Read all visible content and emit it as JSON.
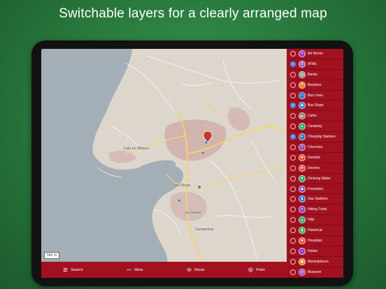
{
  "headline": "Switchable layers for a clearly arranged map",
  "map": {
    "scale_label": "500 m",
    "place_labels": [
      "Cala en Blanes",
      "San Diego",
      "sa Caleta",
      "Santandria"
    ]
  },
  "bottom_bar": {
    "search": "Search",
    "more": "More",
    "route": "Route",
    "point": "Point"
  },
  "layers": [
    {
      "label": "Art Works",
      "checked": false,
      "color": "#8e3cc4",
      "icon": "palette-icon",
      "glyph": "✎"
    },
    {
      "label": "ATMs",
      "checked": true,
      "color": "#9b59b6",
      "icon": "atm-icon",
      "glyph": "$"
    },
    {
      "label": "Banks",
      "checked": false,
      "color": "#7f8c8d",
      "icon": "bank-icon",
      "glyph": "▥"
    },
    {
      "label": "Beaches",
      "checked": false,
      "color": "#e67e22",
      "icon": "beach-icon",
      "glyph": "☂"
    },
    {
      "label": "Bus Lines",
      "checked": false,
      "color": "#2e6fd8",
      "icon": "bus-line-icon",
      "glyph": "▭"
    },
    {
      "label": "Bus Stops",
      "checked": true,
      "color": "#2e6fd8",
      "icon": "bus-stop-icon",
      "glyph": "▣"
    },
    {
      "label": "Cafes",
      "checked": false,
      "color": "#8d6e63",
      "icon": "cafe-icon",
      "glyph": "☕"
    },
    {
      "label": "Camping",
      "checked": false,
      "color": "#27ae60",
      "icon": "tent-icon",
      "glyph": "▲"
    },
    {
      "label": "Charging Stations",
      "checked": true,
      "color": "#2e6fd8",
      "icon": "charging-icon",
      "glyph": "⚡"
    },
    {
      "label": "Churches",
      "checked": false,
      "color": "#8e44ad",
      "icon": "church-icon",
      "glyph": "✝"
    },
    {
      "label": "Dentists",
      "checked": false,
      "color": "#e74c3c",
      "icon": "tooth-icon",
      "glyph": "✚"
    },
    {
      "label": "Doctors",
      "checked": false,
      "color": "#e74c3c",
      "icon": "doctor-icon",
      "glyph": "✚"
    },
    {
      "label": "Drinking Water",
      "checked": false,
      "color": "#27ae60",
      "icon": "water-icon",
      "glyph": "▼"
    },
    {
      "label": "Fountains",
      "checked": false,
      "color": "#8e44ad",
      "icon": "fountain-icon",
      "glyph": "◆"
    },
    {
      "label": "Gas Stations",
      "checked": false,
      "color": "#2e6fd8",
      "icon": "fuel-icon",
      "glyph": "▮"
    },
    {
      "label": "Hiking Trails",
      "checked": false,
      "color": "#8e3cc4",
      "icon": "hiking-icon",
      "glyph": "✈"
    },
    {
      "label": "Hills",
      "checked": false,
      "color": "#27ae60",
      "icon": "mountain-icon",
      "glyph": "▲"
    },
    {
      "label": "Historical",
      "checked": false,
      "color": "#27ae60",
      "icon": "monument-icon",
      "glyph": "▮"
    },
    {
      "label": "Hospitals",
      "checked": false,
      "color": "#e74c3c",
      "icon": "hospital-icon",
      "glyph": "✚"
    },
    {
      "label": "Hotels",
      "checked": false,
      "color": "#8e3cc4",
      "icon": "hotel-icon",
      "glyph": "⌂"
    },
    {
      "label": "Marketplaces",
      "checked": false,
      "color": "#e67e22",
      "icon": "market-icon",
      "glyph": "◼"
    },
    {
      "label": "Museum",
      "checked": false,
      "color": "#8e3cc4",
      "icon": "museum-icon",
      "glyph": "▥"
    },
    {
      "label": "",
      "checked": false,
      "color": "#8e3cc4",
      "icon": "layer-icon",
      "glyph": ""
    }
  ],
  "colors": {
    "accent_red": "#a1111f",
    "check_blue": "#4a8ff0",
    "sea": "#a3aeb6",
    "land": "#dcd6cc"
  }
}
